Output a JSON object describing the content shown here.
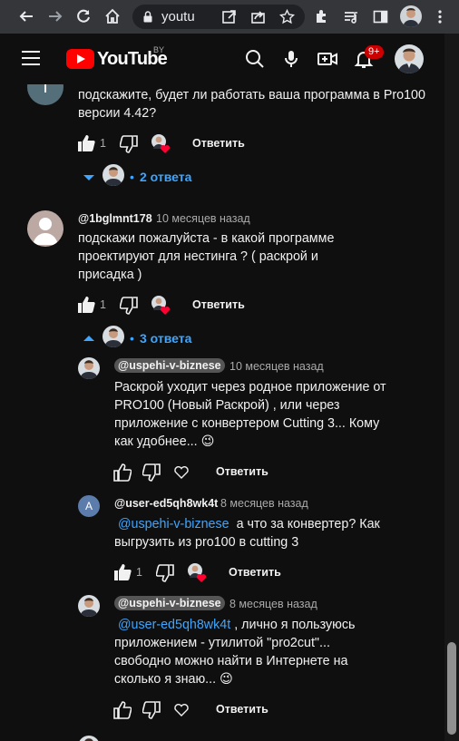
{
  "browser": {
    "url_text": "youtu"
  },
  "header": {
    "logo_text": "YouTube",
    "country_code": "BY",
    "notifications_badge": "9+"
  },
  "comments": [
    {
      "author": "",
      "avatar_letter": "I",
      "text": "подскажите, будет ли работать ваша программа в Pro100 версии 4.42?",
      "likes": "1",
      "reply_label": "Ответить",
      "replies_toggle": "2 ответа"
    },
    {
      "author": "@1bglmnt178",
      "time": "10 месяцев назад",
      "text": "подскажи пожалуйста - в какой программе проектируют  для нестинга ? ( раскрой и присадка )",
      "likes": "1",
      "reply_label": "Ответить",
      "replies_toggle": "3 ответа",
      "replies": [
        {
          "author": "@uspehi-v-biznese",
          "time": "10 месяцев назад",
          "text": "Раскрой уходит через родное приложение от PRO100 (Новый Раскрой) , или через приложение с конвертером Cutting 3... Кому как удобнее... 😉",
          "reply_label": "Ответить"
        },
        {
          "author": "@user-ed5qh8wk4t",
          "avatar_letter": "A",
          "time": "8 месяцев назад",
          "mention": "@uspehi-v-biznese",
          "text": "а что за конвертер? Как выгрузить из pro100 в cutting 3",
          "likes": "1",
          "reply_label": "Ответить"
        },
        {
          "author": "@uspehi-v-biznese",
          "time": "8 месяцев назад",
          "mention": "@user-ed5qh8wk4t",
          "text": ", лично я пользуюсь приложением - утилитой \"pro2cut\"... свободно можно найти в Интернете на сколько я знаю... 😉",
          "reply_label": "Ответить"
        }
      ]
    }
  ],
  "icons": {
    "like": "thumbs-up-icon",
    "dislike": "thumbs-down-icon",
    "heart": "creator-heart-icon"
  },
  "colors": {
    "background": "#0f0f0f",
    "link": "#3ea6ff",
    "brand_red": "#ff0000",
    "muted_text": "#aaaaaa"
  }
}
